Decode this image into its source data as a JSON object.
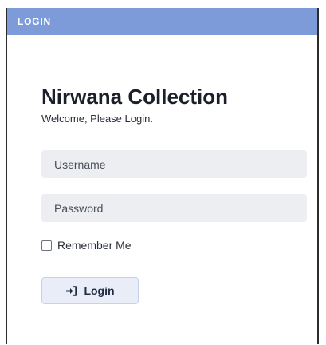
{
  "window": {
    "title": "LOGIN",
    "accent_color": "#7d9ad9"
  },
  "brand": {
    "name": "Nirwana Collection",
    "welcome": "Welcome, Please Login."
  },
  "form": {
    "username": {
      "placeholder": "Username",
      "value": ""
    },
    "password": {
      "placeholder": "Password",
      "value": ""
    },
    "remember_me": {
      "label": "Remember Me",
      "checked": false
    },
    "login_button": {
      "label": "Login",
      "icon": "sign-in-icon"
    }
  }
}
